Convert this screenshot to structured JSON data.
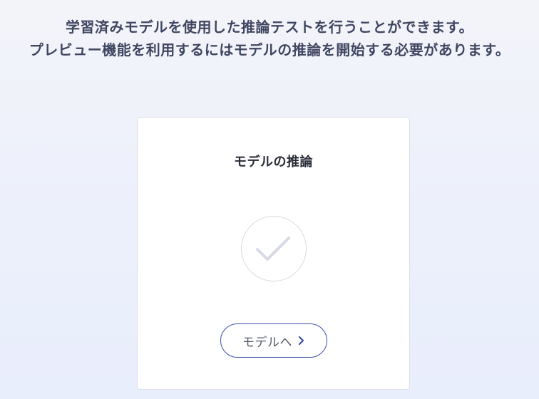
{
  "intro": {
    "line1": "学習済みモデルを使用した推論テストを行うことができます。",
    "line2": "プレビュー機能を利用するにはモデルの推論を開始する必要があります。"
  },
  "card": {
    "title": "モデルの推論",
    "status_icon": "check-icon",
    "button_label": "モデルへ",
    "button_icon": "chevron-right-icon"
  },
  "colors": {
    "background": "#eef1fb",
    "text": "#3f4660",
    "accent": "#3a4fa8",
    "check": "#d7d9e6"
  }
}
